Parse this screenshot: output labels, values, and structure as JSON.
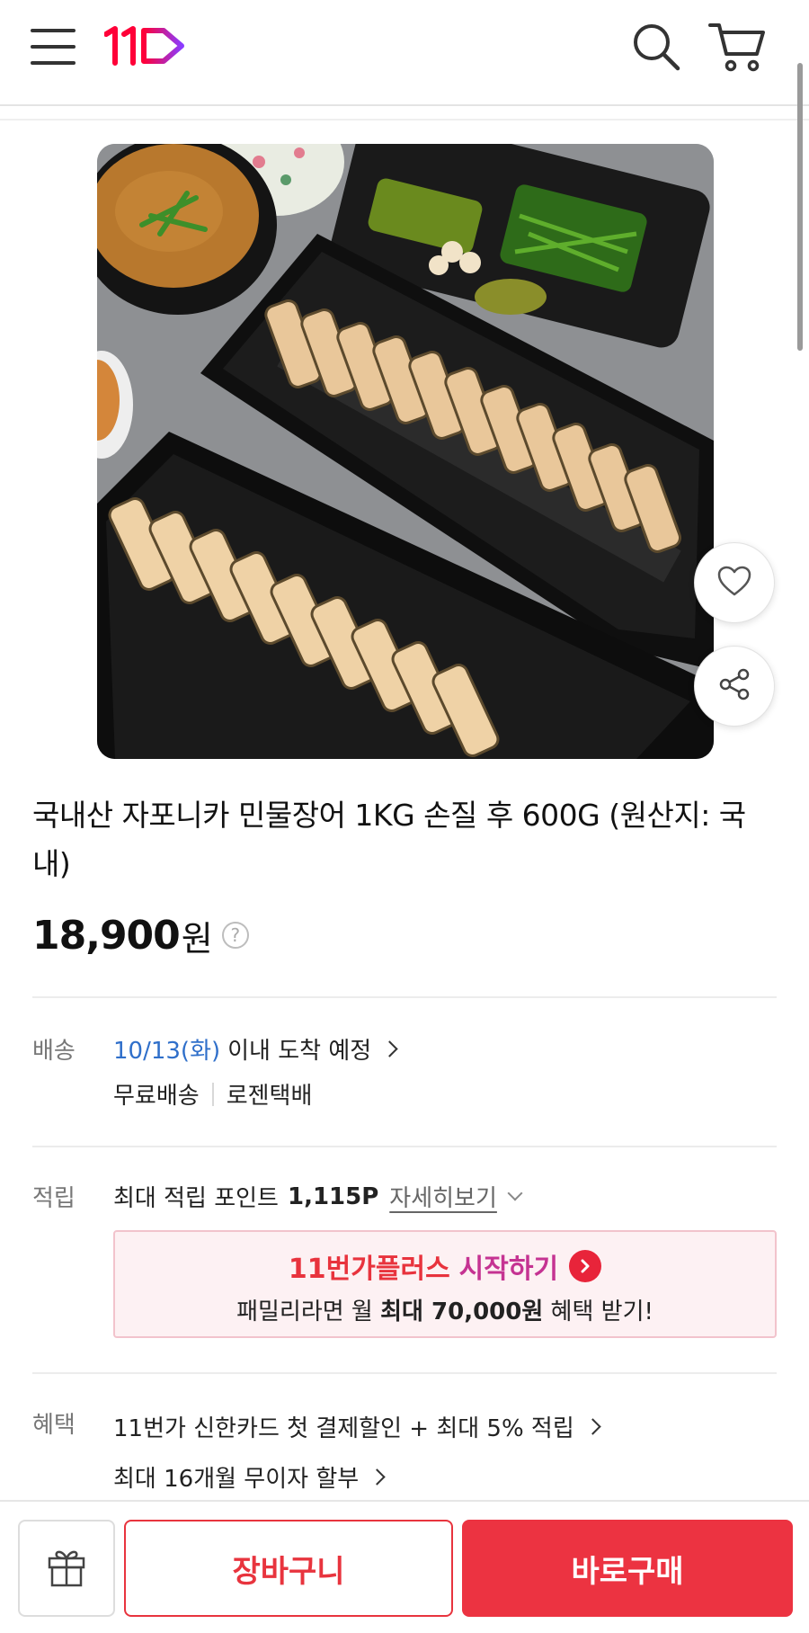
{
  "header": {
    "menu_icon": "hamburger-menu-icon",
    "logo_text": "11",
    "logo_colors": [
      "#ff0038",
      "#8b3bff"
    ],
    "search_icon": "search-icon",
    "cart_icon": "cart-icon"
  },
  "product": {
    "image": "grilled-freshwater-eel-on-black-trays",
    "title": "국내산 자포니카 민물장어 1KG 손질 후 600G (원산지: 국내)",
    "price": "18,900",
    "currency": "원",
    "help_icon_glyph": "?",
    "like_icon": "heart-icon",
    "share_icon": "share-icon"
  },
  "shipping": {
    "label": "배송",
    "date": "10/13(화)",
    "eta_text": "이내 도착 예정",
    "fee": "무료배송",
    "carrier": "로젠택배"
  },
  "points": {
    "label": "적립",
    "prefix": "최대 적립 포인트",
    "amount": "1,115P",
    "detail_link": "자세히보기",
    "promo": {
      "title_part1": "11번가플러스",
      "title_part2": "시작하기",
      "desc_prefix": "패밀리라면 월",
      "desc_bold": "최대 70,000원",
      "desc_suffix": "혜택 받기!"
    }
  },
  "benefits": {
    "label": "혜택",
    "line1": "11번가 신한카드 첫 결제할인 + 최대 5% 적립",
    "line2": "최대 16개월 무이자 할부"
  },
  "bottom_bar": {
    "gift_icon": "gift-icon",
    "cart_label": "장바구니",
    "buy_label": "바로구매",
    "accent_color": "#ec3341"
  }
}
